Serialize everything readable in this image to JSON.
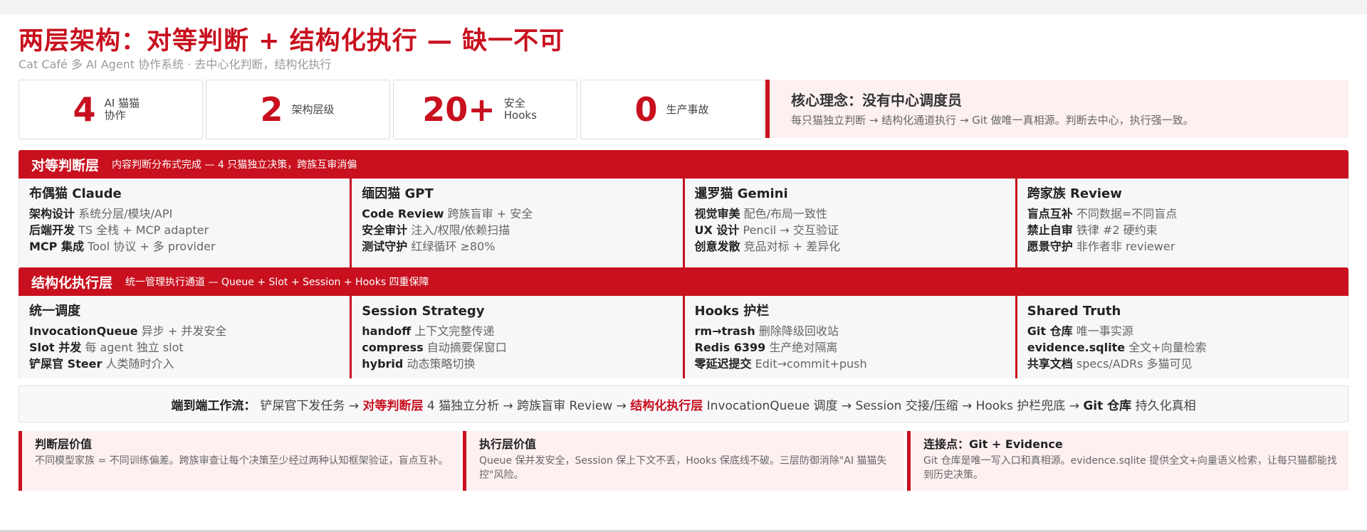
{
  "title": "两层架构：对等判断 + 结构化执行 — 缺一不可",
  "subtitle": "Cat Café 多 AI Agent 协作系统 · 去中心化判断，结构化执行",
  "stats": [
    {
      "num": "4",
      "label": "AI 猫猫协作"
    },
    {
      "num": "2",
      "label": "架构层级"
    },
    {
      "num": "20+",
      "label": "安全 Hooks"
    },
    {
      "num": "0",
      "label": "生产事故"
    }
  ],
  "core": {
    "title": "核心理念：没有中心调度员",
    "text": "每只猫独立判断 → 结构化通道执行 → Git 做唯一真相源。判断去中心，执行强一致。"
  },
  "peer_layer": {
    "title": "对等判断层",
    "desc": "内容判断分布式完成 — 4 只猫独立决策，跨族互审消偏",
    "cards": [
      {
        "title": "布偶猫 Claude",
        "lines": [
          {
            "k": "架构设计",
            "v": "系统分层/模块/API"
          },
          {
            "k": "后端开发",
            "v": "TS 全栈 + MCP adapter"
          },
          {
            "k": "MCP 集成",
            "v": "Tool 协议 + 多 provider"
          }
        ]
      },
      {
        "title": "缅因猫 GPT",
        "lines": [
          {
            "k": "Code Review",
            "v": "跨族盲审 + 安全"
          },
          {
            "k": "安全审计",
            "v": "注入/权限/依赖扫描"
          },
          {
            "k": "测试守护",
            "v": "红绿循环 ≥80%"
          }
        ]
      },
      {
        "title": "暹罗猫 Gemini",
        "lines": [
          {
            "k": "视觉审美",
            "v": "配色/布局一致性"
          },
          {
            "k": "UX 设计",
            "v": "Pencil → 交互验证"
          },
          {
            "k": "创意发散",
            "v": "竞品对标 + 差异化"
          }
        ]
      },
      {
        "title": "跨家族 Review",
        "lines": [
          {
            "k": "盲点互补",
            "v": "不同数据=不同盲点"
          },
          {
            "k": "禁止自审",
            "v": "铁律 #2 硬约束"
          },
          {
            "k": "愿景守护",
            "v": "非作者非 reviewer"
          }
        ]
      }
    ]
  },
  "exec_layer": {
    "title": "结构化执行层",
    "desc": "统一管理执行通道 — Queue + Slot + Session + Hooks 四重保障",
    "cards": [
      {
        "title": "统一调度",
        "lines": [
          {
            "k": "InvocationQueue",
            "v": "异步 + 并发安全"
          },
          {
            "k": "Slot 并发",
            "v": "每 agent 独立 slot"
          },
          {
            "k": "铲屎官 Steer",
            "v": "人类随时介入"
          }
        ]
      },
      {
        "title": "Session Strategy",
        "lines": [
          {
            "k": "handoff",
            "v": "上下文完整传递"
          },
          {
            "k": "compress",
            "v": "自动摘要保窗口"
          },
          {
            "k": "hybrid",
            "v": "动态策略切换"
          }
        ]
      },
      {
        "title": "Hooks 护栏",
        "lines": [
          {
            "k": "rm→trash",
            "v": "删除降级回收站"
          },
          {
            "k": "Redis 6399",
            "v": "生产绝对隔离"
          },
          {
            "k": "零延迟提交",
            "v": "Edit→commit+push"
          }
        ]
      },
      {
        "title": "Shared Truth",
        "lines": [
          {
            "k": "Git 仓库",
            "v": "唯一事实源"
          },
          {
            "k": "evidence.sqlite",
            "v": "全文+向量检索"
          },
          {
            "k": "共享文档",
            "v": "specs/ADRs 多猫可见"
          }
        ]
      }
    ]
  },
  "flow": {
    "lead": "端到端工作流：",
    "p1": "铲屎官下发任务 →",
    "r1": "对等判断层",
    "p2": "4 猫独立分析 → 跨族盲审 Review →",
    "r2": "结构化执行层",
    "p3": "InvocationQueue 调度 → Session 交接/压缩 → Hooks 护栏兜底 →",
    "b1": "Git 仓库",
    "p4": "持久化真相"
  },
  "values": [
    {
      "title": "判断层价值",
      "text": "不同模型家族 = 不同训练偏差。跨族审查让每个决策至少经过两种认知框架验证，盲点互补。"
    },
    {
      "title": "执行层价值",
      "text": "Queue 保并发安全，Session 保上下文不丢，Hooks 保底线不破。三层防御消除\"AI 猫猫失控\"风险。"
    },
    {
      "title": "连接点：Git + Evidence",
      "text": "Git 仓库是唯一写入口和真相源。evidence.sqlite 提供全文+向量语义检索，让每只猫都能找到历史决策。"
    }
  ],
  "colors": {
    "accent": "#c8101e",
    "soft": "#fdf0f1"
  }
}
